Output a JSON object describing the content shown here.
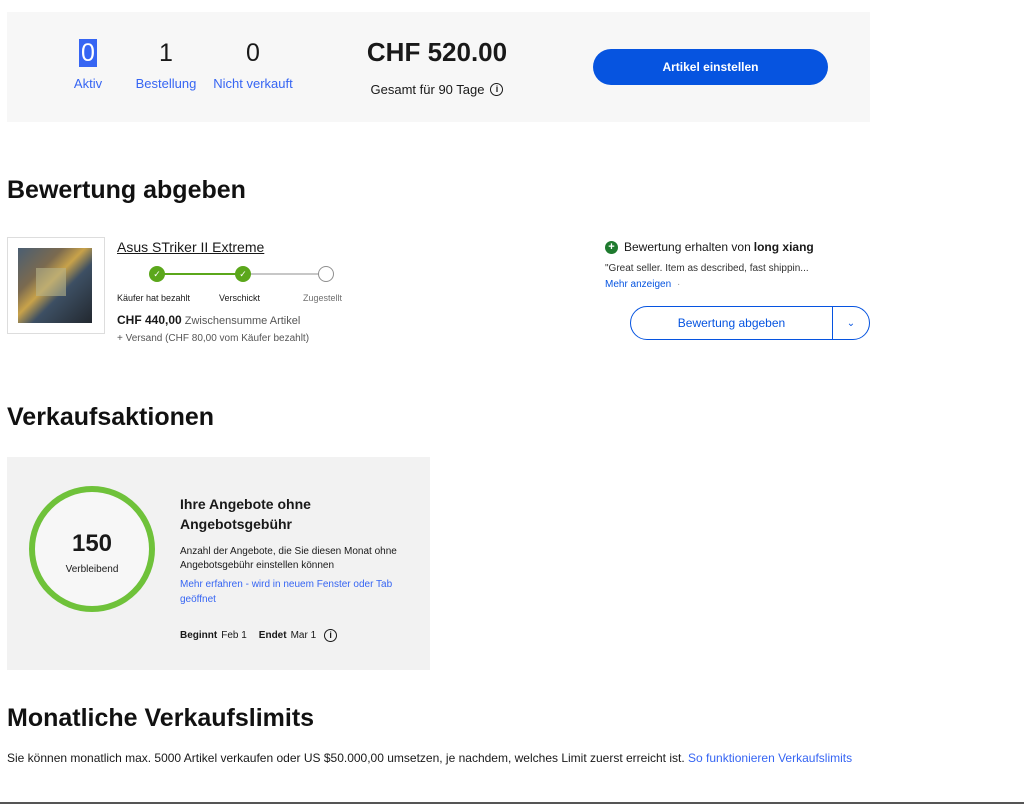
{
  "summary": {
    "active_count": "0",
    "active_label": "Aktiv",
    "orders_count": "1",
    "orders_label": "Bestellung",
    "unsold_count": "0",
    "unsold_label": "Nicht verkauft",
    "total_amount": "CHF 520.00",
    "total_label": "Gesamt für 90 Tage",
    "list_button": "Artikel einstellen"
  },
  "feedback": {
    "heading": "Bewertung abgeben",
    "item": {
      "title": "Asus STriker II Extreme",
      "steps": [
        "Käufer hat bezahlt",
        "Verschickt",
        "Zugestellt"
      ],
      "progress_completed_steps": 2,
      "price": "CHF 440,00",
      "price_note": "Zwischensumme Artikel",
      "shipping": "+ Versand (CHF 80,00 vom Käufer bezahlt)"
    },
    "received_prefix": "Bewertung erhalten von",
    "received_from": "long xiang",
    "quote": "\"Great seller. Item as described, fast shippin...",
    "more_link": "Mehr anzeigen",
    "more_dot": "·",
    "button": "Bewertung abgeben"
  },
  "promotions": {
    "heading": "Verkaufsaktionen",
    "remaining_count": "150",
    "remaining_label": "Verbleibend",
    "title": "Ihre Angebote ohne Angebotsgebühr",
    "description": "Anzahl der Angebote, die Sie diesen Monat ohne Angebotsgebühr einstellen können",
    "link": "Mehr erfahren - wird in neuem Fenster oder Tab geöffnet",
    "starts_label": "Beginnt",
    "starts_value": "Feb 1",
    "ends_label": "Endet",
    "ends_value": "Mar 1"
  },
  "limits": {
    "heading": "Monatliche Verkaufslimits",
    "text": "Sie können monatlich max. 5000 Artikel verkaufen oder US $50.000,00 umsetzen, je nachdem, welches Limit zuerst erreicht ist.",
    "link": "So funktionieren Verkaufslimits"
  },
  "colors": {
    "primary": "#0654e0",
    "link": "#3665f3",
    "progress_done": "#5ba71b",
    "ring": "#6fc23a"
  },
  "icons": [
    "info-icon",
    "check-icon",
    "plus-circle-icon",
    "chevron-down-icon"
  ]
}
